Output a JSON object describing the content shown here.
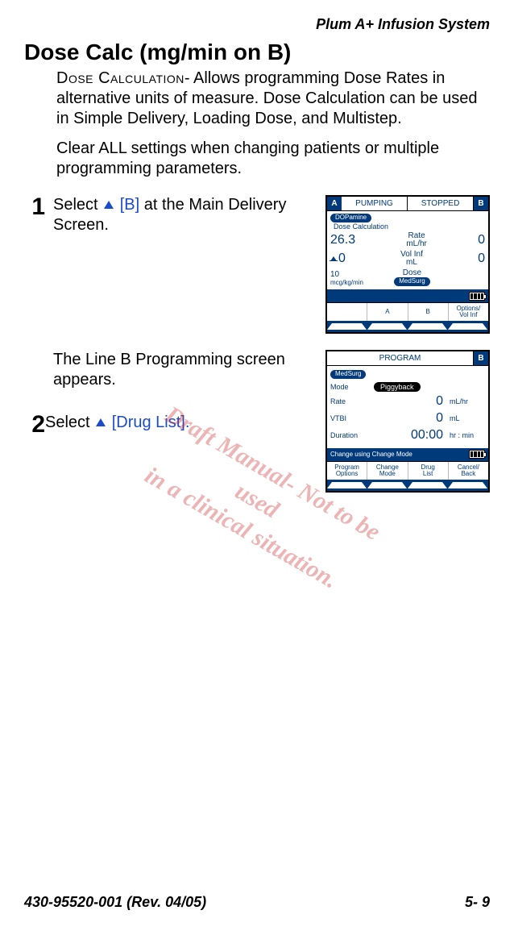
{
  "header": {
    "running_title": "Plum A+ Infusion System",
    "section_title": "Dose Calc (mg/min on B)"
  },
  "intro": {
    "lead": "Dose Calculation",
    "body1": "- Allows programming Dose Rates in alternative units of measure. Dose Calculation can be used in Simple Delivery, Loading Dose, and Multistep.",
    "body2": "Clear ALL settings when changing patients or multiple programming parameters."
  },
  "steps": {
    "s1": {
      "num": "1",
      "pre": "Select ",
      "link": "[B]",
      "post": " at the Main Delivery Screen."
    },
    "s1b": {
      "text": "The Line B Programming screen appears."
    },
    "s2": {
      "num": "2",
      "pre": "Select ",
      "link": "[Drug List].",
      "post": ""
    }
  },
  "screen1": {
    "top": {
      "a": "A",
      "pumping": "PUMPING",
      "stopped": "STOPPED",
      "b": "B"
    },
    "drug": "DOPamine",
    "sub": "Dose Calculation",
    "rate_val_a": "26.3",
    "rate_label": "Rate",
    "rate_unit": "mL/hr",
    "rate_val_b": "0",
    "vol_val_a": "0",
    "vol_label": "Vol Inf",
    "vol_unit": "mL",
    "vol_val_b": "0",
    "dose_val": "10",
    "dose_unit": "mcg/kg/min",
    "dose_label": "Dose",
    "care": "MedSurg",
    "soft": {
      "a": "A",
      "b": "B",
      "opt1": "Options/",
      "opt2": "Vol Inf"
    }
  },
  "screen2": {
    "top": {
      "title": "PROGRAM",
      "b": "B"
    },
    "care": "MedSurg",
    "mode_label": "Mode",
    "mode_val": "Piggyback",
    "rate_label": "Rate",
    "rate_val": "0",
    "rate_unit": "mL/hr",
    "vtbi_label": "VTBI",
    "vtbi_val": "0",
    "vtbi_unit": "mL",
    "dur_label": "Duration",
    "dur_val": "00:00",
    "dur_unit": "hr : min",
    "status": "Change using Change Mode",
    "soft": {
      "a1": "Program",
      "a2": "Options",
      "b1": "Change",
      "b2": "Mode",
      "c1": "Drug",
      "c2": "List",
      "d1": "Cancel/",
      "d2": "Back"
    }
  },
  "footer": {
    "left": "430-95520-001 (Rev. 04/05)",
    "right": "5- 9"
  },
  "watermark": {
    "l1": "Draft Manual- Not to be used",
    "l2": "in a clinical situation."
  }
}
